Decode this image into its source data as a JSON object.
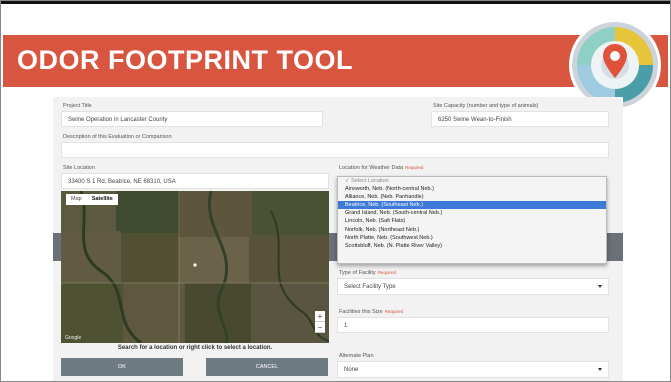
{
  "app": {
    "title": "ODOR FOOTPRINT TOOL"
  },
  "colors": {
    "banner": "#d8553f",
    "selected": "#3d79d6",
    "button": "#6f7b83"
  },
  "logo": {
    "icon": "map-pin-target-icon"
  },
  "form": {
    "project_title": {
      "label": "Project Title",
      "value": "Swine Operation in Lancaster County"
    },
    "site_capacity": {
      "label": "Site Capacity (number and type of animals)",
      "value": "6250 Swine Wean-to-Finish"
    },
    "description": {
      "label": "Description of this Evaluation or Comparison",
      "value": ""
    },
    "site_location": {
      "label": "Site Location",
      "value": "33400 S 1 Rd, Beatrice, NE 68310, USA"
    },
    "weather_location": {
      "label": "Location for Weather Data",
      "required": "Required",
      "options": [
        "✓ Select Location",
        "Ainsworth, Neb. (North-central Neb.)",
        "Alliance, Neb. (Neb. Panhandle)",
        "Beatrice, Neb. (Southeast Neb.)",
        "Grand Island, Neb. (South-central Neb.)",
        "Lincoln, Neb. (Salt Flats)",
        "Norfolk, Neb. (Northeast Neb.)",
        "North Platte, Neb. (Southwest Neb.)",
        "Scottsbluff, Neb. (N. Platte River Valley)"
      ],
      "selected_index": 3
    },
    "facility_type": {
      "label": "Type of Facility",
      "required": "Required",
      "value": "Select Facility Type"
    },
    "facilities_this_size": {
      "label": "Facilities this Size",
      "required": "Required",
      "value": "1"
    },
    "alternate_plan": {
      "label": "Alternate Plan",
      "value": "None"
    }
  },
  "map": {
    "tabs": [
      "Map",
      "Satellite"
    ],
    "active_tab": "Satellite",
    "google_label": "Google",
    "zoom_in": "+",
    "zoom_out": "−",
    "hint": "Search for a location or right click to select a location."
  },
  "buttons": {
    "ok": "OK",
    "cancel": "CANCEL"
  }
}
